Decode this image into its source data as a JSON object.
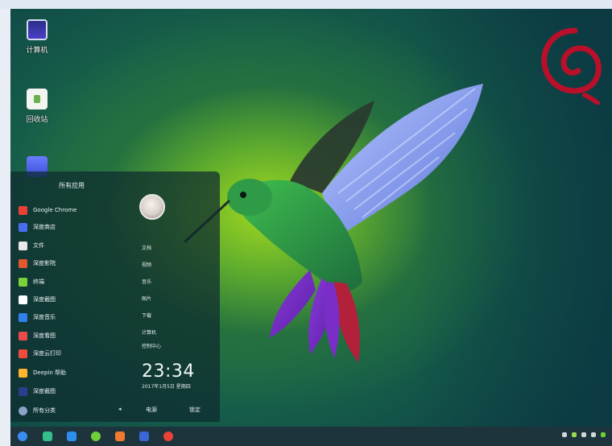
{
  "desktop": {
    "icons": [
      {
        "label": "计算机",
        "icon": "computer-icon"
      },
      {
        "label": "回收站",
        "icon": "trash-icon"
      },
      {
        "label": "",
        "icon": "app-icon"
      }
    ]
  },
  "start_menu": {
    "header": "所有应用",
    "apps": [
      {
        "label": "Google Chrome",
        "icon": "chrome-icon",
        "color": "#e94235"
      },
      {
        "label": "深度商店",
        "icon": "store-icon",
        "color": "#4a6cf0"
      },
      {
        "label": "文件",
        "icon": "files-icon",
        "color": "#e9e9e9"
      },
      {
        "label": "深度影院",
        "icon": "movie-icon",
        "color": "#e4572e"
      },
      {
        "label": "终端",
        "icon": "terminal-icon",
        "color": "#7bd33a"
      },
      {
        "label": "深度截图",
        "icon": "screenshot-icon",
        "color": "#ffffff"
      },
      {
        "label": "深度音乐",
        "icon": "music-icon",
        "color": "#2f80ed"
      },
      {
        "label": "深度看图",
        "icon": "image-viewer-icon",
        "color": "#e94a4a"
      },
      {
        "label": "深度云打印",
        "icon": "print-icon",
        "color": "#f04b3c"
      },
      {
        "label": "Deepin 帮助",
        "icon": "help-icon",
        "color": "#ffb52e"
      },
      {
        "label": "深度截图",
        "icon": "capture-icon",
        "color": "#2a3d8f"
      },
      {
        "label": "所有分类",
        "icon": "categories-icon",
        "color": "#8aa4c8"
      }
    ],
    "right_links": [
      "文档",
      "视频",
      "音乐",
      "图片",
      "下载",
      "计算机",
      "控制中心"
    ],
    "clock": "23:34",
    "date": "2017年1月5日 星期四",
    "bottom": {
      "left_arrow": "◂",
      "power_label": "电源",
      "lock_label": "锁定"
    }
  },
  "taskbar": {
    "icons": [
      {
        "name": "launcher-icon",
        "color": "#3b8cf0"
      },
      {
        "name": "multitask-icon",
        "color": "#33c08a"
      },
      {
        "name": "files-icon",
        "color": "#2f8ff0"
      },
      {
        "name": "browser-icon",
        "color": "#6fcf3a"
      },
      {
        "name": "store-icon",
        "color": "#f07a2f"
      },
      {
        "name": "app-icon",
        "color": "#3a66d8"
      },
      {
        "name": "chrome-icon",
        "color": "#ea4335"
      }
    ]
  }
}
